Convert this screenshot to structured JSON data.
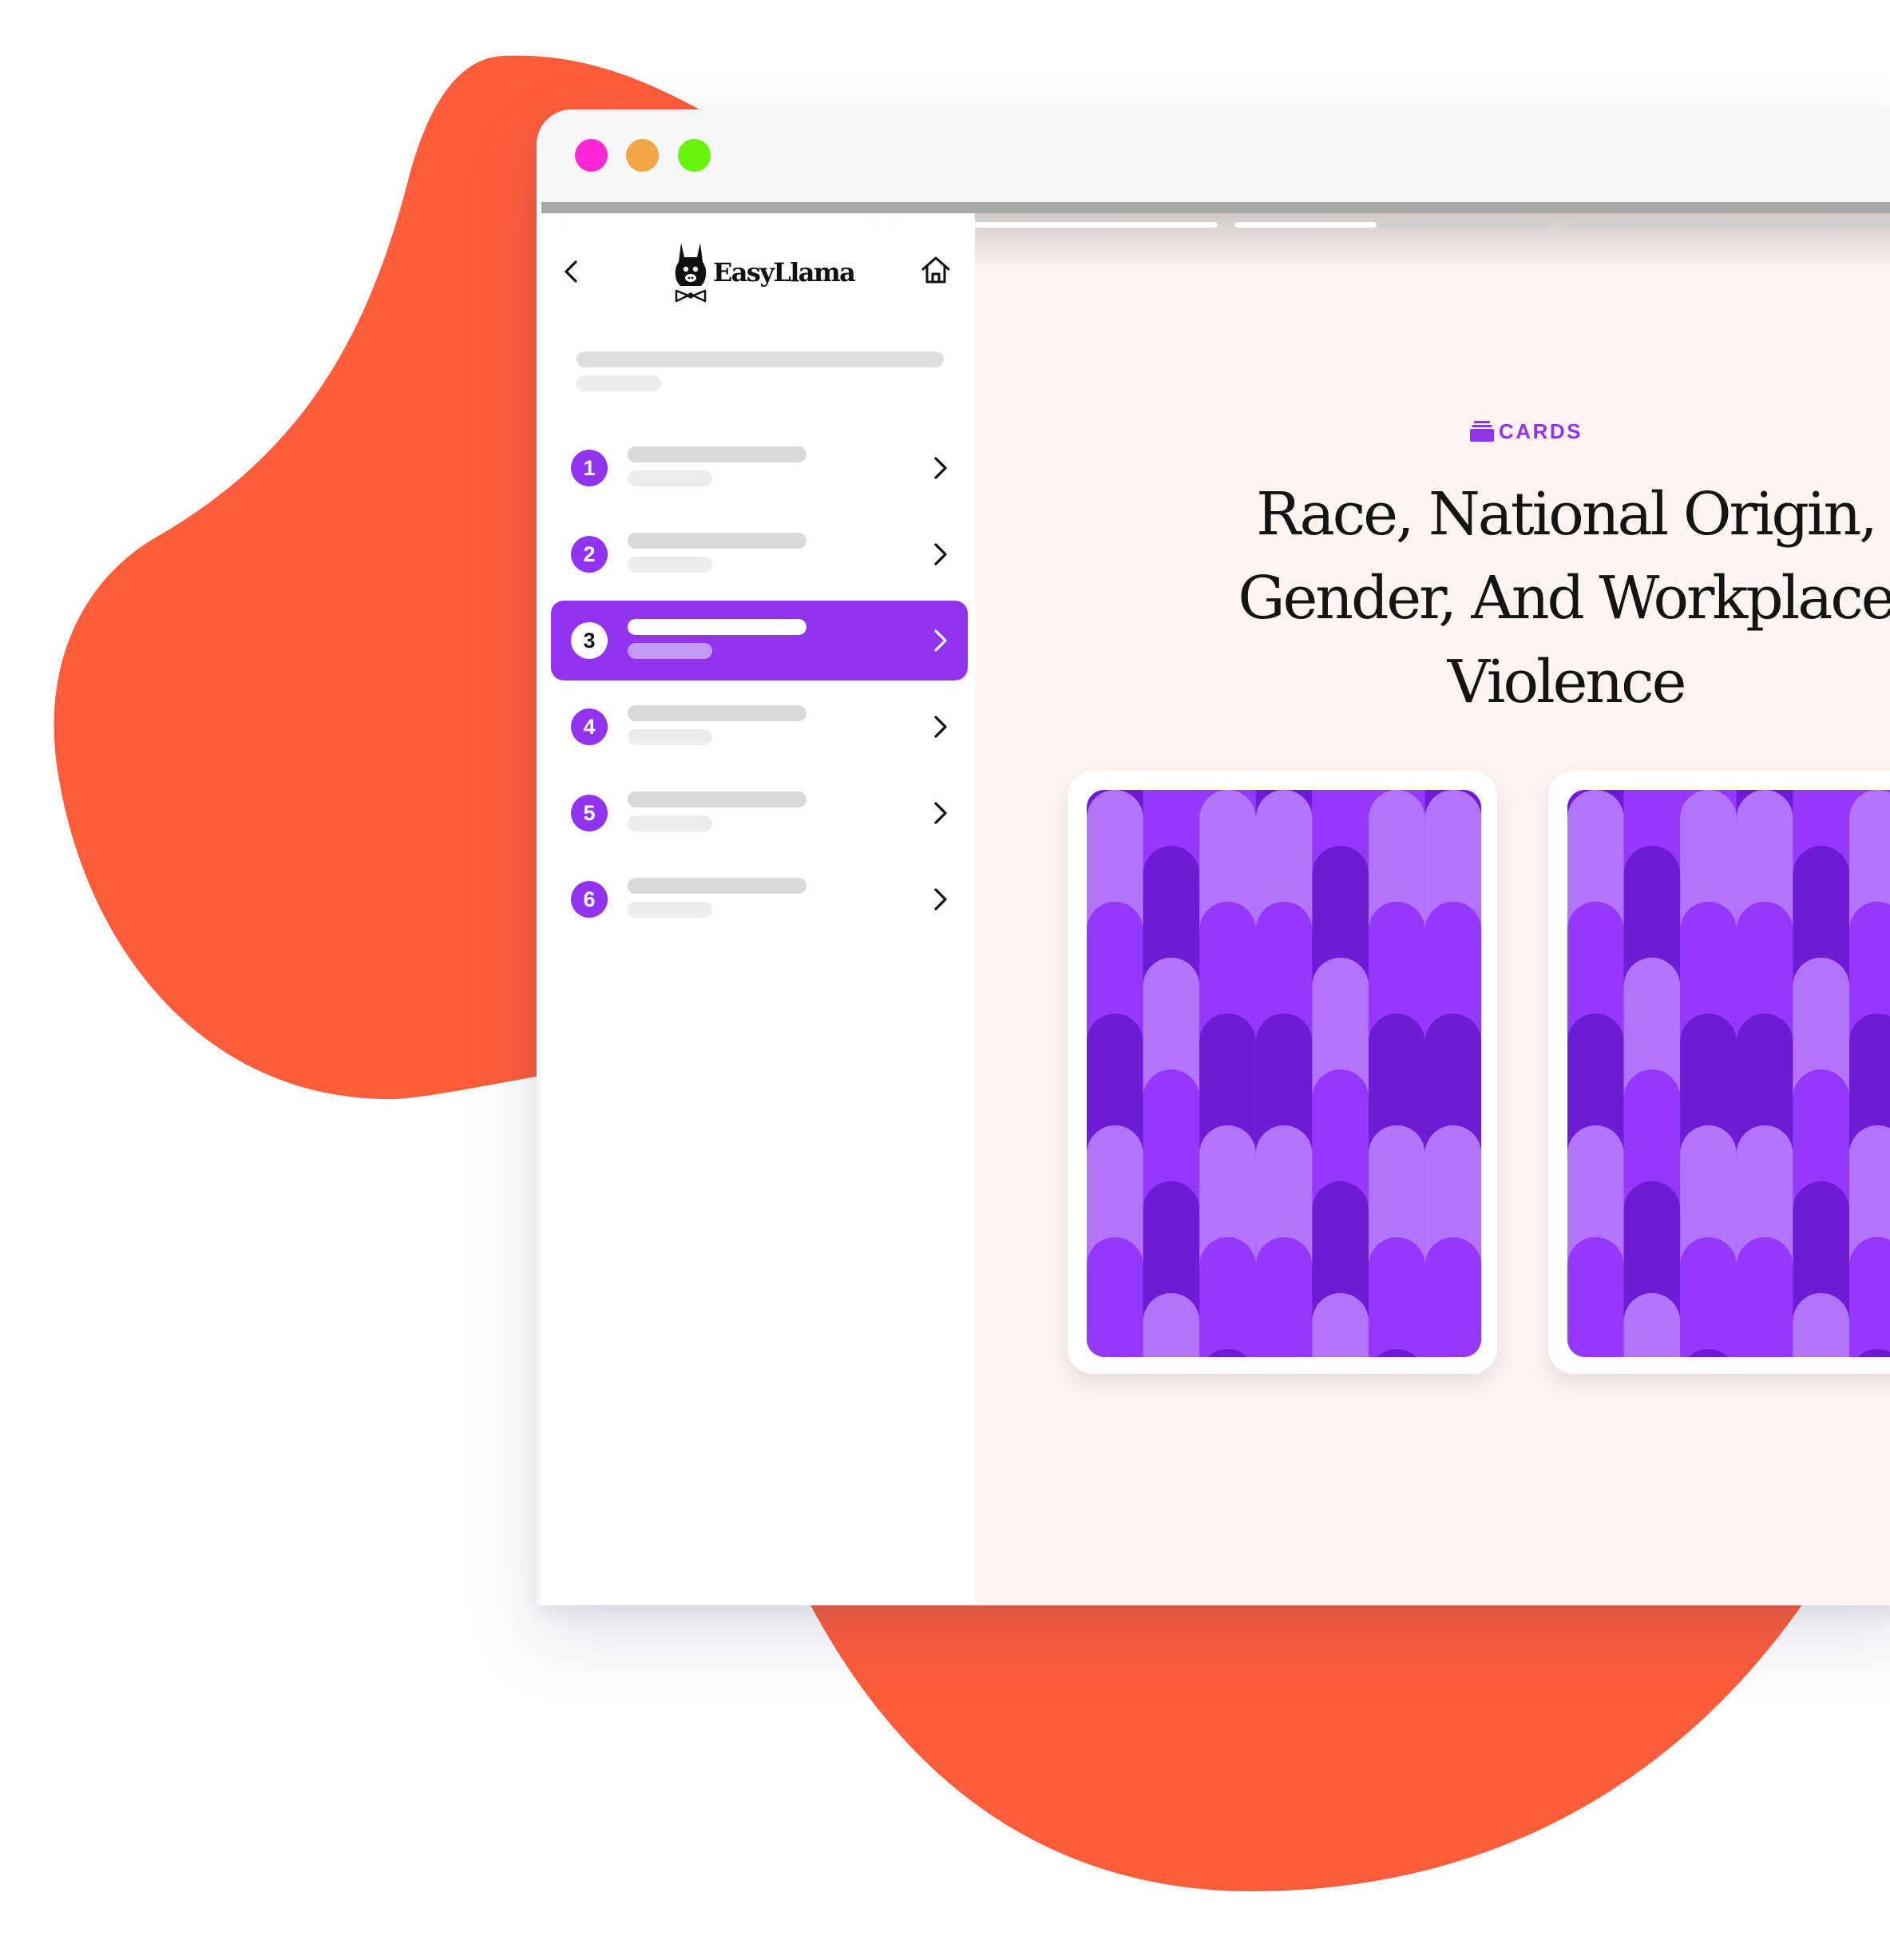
{
  "colors": {
    "accent": "#9333f2",
    "blob": "#fe5c3a",
    "dot_close": "#ff28d4",
    "dot_minimize": "#f1a646",
    "dot_zoom": "#66f40c",
    "pattern_dark": "#6e1bd6",
    "pattern_mid": "#9438fd",
    "pattern_light": "#b374fb"
  },
  "window": {
    "controls": [
      "close",
      "minimize",
      "zoom"
    ]
  },
  "progress": {
    "segments": [
      1,
      1,
      0.45,
      0
    ]
  },
  "sidebar": {
    "brand": "EasyLlama",
    "back_icon": "chevron-left-icon",
    "home_icon": "home-icon",
    "lessons": [
      {
        "number": "1",
        "active": false
      },
      {
        "number": "2",
        "active": false
      },
      {
        "number": "3",
        "active": true
      },
      {
        "number": "4",
        "active": false
      },
      {
        "number": "5",
        "active": false
      },
      {
        "number": "6",
        "active": false
      }
    ]
  },
  "main": {
    "kicker": "CARDS",
    "kicker_icon": "card-stack-icon",
    "title": "Race, National Origin, Gender, And Workplace Violence",
    "cards": [
      "card-back-1",
      "card-back-2"
    ]
  }
}
